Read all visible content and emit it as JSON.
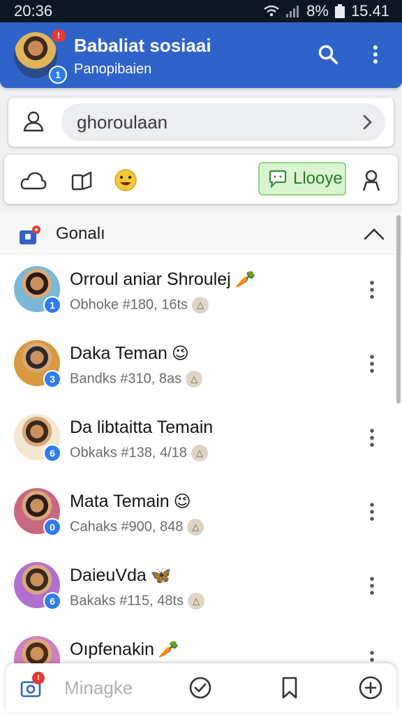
{
  "status_bar": {
    "time": "20:36",
    "battery": "8%",
    "clock_right": "15.41",
    "icons": [
      "wifi-icon",
      "signal-icon",
      "battery-icon"
    ]
  },
  "header": {
    "title": "Babaliat sosiaai",
    "subtitle": "Panopibaien",
    "notification_count": "!",
    "avatar_badge": "1",
    "icons": [
      "search-icon",
      "more-vertical-icon"
    ]
  },
  "search": {
    "value": "ghoroulaan",
    "icons": [
      "person-icon",
      "chevron-right-icon"
    ]
  },
  "toolbar": {
    "like_label": "Llooye",
    "icons": [
      "cloud-icon",
      "share-icon",
      "emoji-icon",
      "chat-icon",
      "user-icon"
    ]
  },
  "group": {
    "title": "Gonalı",
    "icons": [
      "group-camera-icon",
      "chevron-up-icon"
    ]
  },
  "contacts": [
    {
      "name": "Orroul aniar Shroulej",
      "emoji": "🥕",
      "meta": "Obhoke #180, 16ts",
      "badge": "1",
      "colors": [
        "#7ab8d8",
        "#2a1a10"
      ]
    },
    {
      "name": "Daka Teman",
      "emoji": "😉",
      "meta": "Bandks #310, 8as",
      "badge": "3",
      "colors": [
        "#d89a40",
        "#2a2a2a"
      ]
    },
    {
      "name": "Da libtaitta Temain",
      "emoji": "",
      "meta": "Obkaks #138, 4/18",
      "badge": "6",
      "colors": [
        "#f4e8d0",
        "#3a2818"
      ]
    },
    {
      "name": "Mata Temain",
      "emoji": "😉",
      "meta": "Cahaks #900, 848",
      "badge": "0",
      "colors": [
        "#c86880",
        "#2a1a1a"
      ]
    },
    {
      "name": "DaieuVda",
      "emoji": "🦋",
      "meta": "Bakaks #115, 48ts",
      "badge": "6",
      "colors": [
        "#b070d0",
        "#3a2a1a"
      ]
    },
    {
      "name": "Oıpfenakin",
      "emoji": "🥕",
      "meta": "",
      "badge": "",
      "colors": [
        "#d080c0",
        "#4a2818"
      ]
    }
  ],
  "compose": {
    "placeholder": "Minagke",
    "camera_badge": "!",
    "icons": [
      "camera-icon",
      "check-circle-icon",
      "bookmark-icon",
      "plus-circle-icon"
    ]
  },
  "colors": {
    "header_blue": "#2f63c9",
    "badge_blue": "#2e7df0",
    "badge_red": "#e53935",
    "like_green": "#d8f5cf"
  }
}
